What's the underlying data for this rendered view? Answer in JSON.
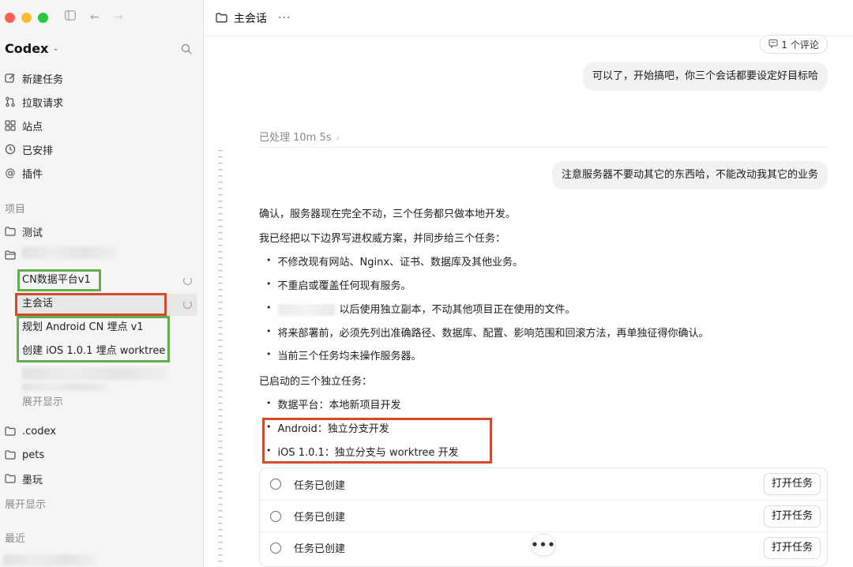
{
  "sidebar": {
    "app_title": "Codex",
    "nav": [
      {
        "label": "新建任务",
        "icon": "edit-icon"
      },
      {
        "label": "拉取请求",
        "icon": "pull-request-icon"
      },
      {
        "label": "站点",
        "icon": "grid-icon"
      },
      {
        "label": "已安排",
        "icon": "clock-icon"
      },
      {
        "label": "插件",
        "icon": "at-plugin-icon"
      }
    ],
    "projects_label": "项目",
    "projects": [
      {
        "label": "测试"
      },
      {
        "label": ".codex"
      },
      {
        "label": "pets"
      },
      {
        "label": "墨玩"
      }
    ],
    "threads": [
      {
        "label": "CN数据平台v1",
        "running": true
      },
      {
        "label": "主会话",
        "running": true,
        "active": true
      },
      {
        "label": "规划 Android CN 埋点 v1"
      },
      {
        "label": "创建 iOS 1.0.1 埋点 worktree"
      }
    ],
    "expand_label_1": "展开显示",
    "expand_label_2": "展开显示",
    "recent_label": "最近"
  },
  "header": {
    "title": "主会话",
    "more": "···"
  },
  "chat": {
    "comment_chip": "1 个评论",
    "user_msg_1": "可以了，开始搞吧，你三个会话都要设定好目标哈",
    "processed": "已处理 10m 5s",
    "user_msg_2": "注意服务器不要动其它的东西哈，不能改动我其它的业务",
    "para_1": "确认，服务器现在完全不动，三个任务都只做本地开发。",
    "para_2": "我已经把以下边界写进权威方案，并同步给三个任务：",
    "bullets_1": [
      "不修改现有网站、Nginx、证书、数据库及其他业务。",
      "不重启或覆盖任何现有服务。",
      "以后使用独立副本，不动其他项目正在使用的文件。",
      "将来部署前，必须先列出准确路径、数据库、配置、影响范围和回滚方法，再单独征得你确认。",
      "当前三个任务均未操作服务器。"
    ],
    "para_3": "已启动的三个独立任务：",
    "bullets_2": [
      "数据平台：本地新项目开发",
      "Android：独立分支开发",
      "iOS 1.0.1：独立分支与 worktree 开发"
    ],
    "tasks": [
      {
        "label": "任务已创建",
        "button": "打开任务"
      },
      {
        "label": "任务已创建",
        "button": "打开任务"
      },
      {
        "label": "任务已创建",
        "button": "打开任务"
      }
    ],
    "more_button": "•••"
  },
  "colors": {
    "highlight_green": "#62ad4e",
    "highlight_red": "#d24a2c",
    "sidebar_bg": "#f5f5f4"
  }
}
